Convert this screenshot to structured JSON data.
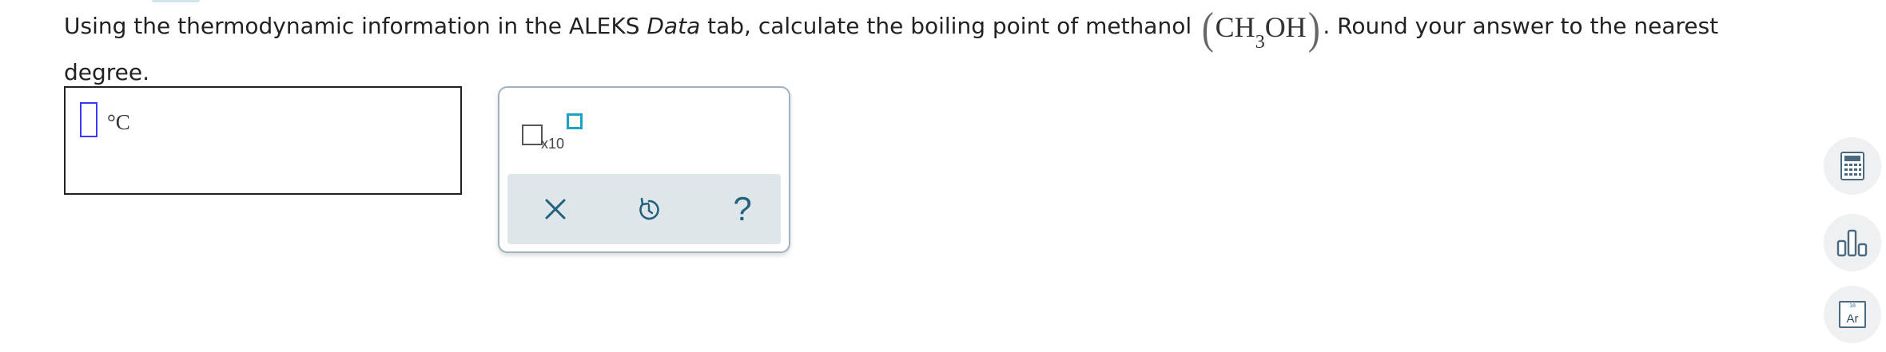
{
  "question": {
    "part1": "Using the thermodynamic information in the ALEKS ",
    "data_word": "Data",
    "part2": " tab, calculate the boiling point of methanol ",
    "formula": {
      "paren_open": "(",
      "pre": "CH",
      "sub": "3",
      "post": "OH",
      "paren_close": ")"
    },
    "part3": ". Round your answer to the nearest degree."
  },
  "answer": {
    "value": "",
    "unit": "°C"
  },
  "palette": {
    "sci_notation_label": "x10",
    "clear_icon": "close-icon",
    "undo_icon": "undo-icon",
    "help_label": "?"
  },
  "side_tools": {
    "calculator_icon": "calculator-icon",
    "data_icon": "bar-chart-icon",
    "periodic_table": {
      "atomic_number": "18",
      "symbol": "Ar"
    }
  },
  "colors": {
    "caret_blue": "#3a3aff",
    "exponent_box_teal": "#1ba3c6",
    "action_icon": "#25607e",
    "palette_border": "#9fb2be",
    "palette_action_bg": "#dfe6ea",
    "side_tool_bg": "#eef0f1"
  }
}
